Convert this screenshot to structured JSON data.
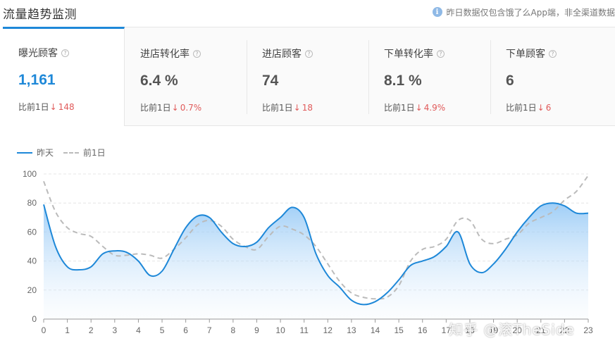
{
  "header": {
    "title": "流量趋势监测",
    "notice": "昨日数据仅包含饿了么App端，非全渠道数据",
    "info_icon": "info-icon"
  },
  "kpis": [
    {
      "label": "曝光顾客",
      "value": "1,161",
      "compare_label": "比前1日",
      "change": "148",
      "direction": "down",
      "active": true
    },
    {
      "label": "进店转化率",
      "value": "6.4 %",
      "compare_label": "比前1日",
      "change": "0.7%",
      "direction": "down",
      "active": false
    },
    {
      "label": "进店顾客",
      "value": "74",
      "compare_label": "比前1日",
      "change": "18",
      "direction": "down",
      "active": false
    },
    {
      "label": "下单转化率",
      "value": "8.1 %",
      "compare_label": "比前1日",
      "change": "4.9%",
      "direction": "down",
      "active": false
    },
    {
      "label": "下单顾客",
      "value": "6",
      "compare_label": "比前1日",
      "change": "6",
      "direction": "down",
      "active": false
    }
  ],
  "legend": {
    "current": "昨天",
    "previous": "前1日"
  },
  "watermark": "知乎 @滚TheSide",
  "colors": {
    "accent": "#1e88d8",
    "previous_line": "#bbbbbb",
    "down": "#e05a5a"
  },
  "chart_data": {
    "type": "line",
    "x": [
      0,
      0.5,
      1,
      1.5,
      2,
      2.5,
      3,
      3.5,
      4,
      4.5,
      5,
      5.5,
      6,
      6.5,
      7,
      7.5,
      8,
      8.5,
      9,
      9.5,
      10,
      10.5,
      11,
      11.5,
      12,
      12.5,
      13,
      13.5,
      14,
      14.5,
      15,
      15.5,
      16,
      16.5,
      17,
      17.5,
      18,
      18.5,
      19,
      19.5,
      20,
      20.5,
      21,
      21.5,
      22,
      22.5,
      23
    ],
    "xticks": [
      0,
      1,
      2,
      3,
      4,
      5,
      6,
      7,
      8,
      9,
      10,
      11,
      12,
      13,
      14,
      15,
      16,
      17,
      18,
      19,
      20,
      21,
      22,
      23
    ],
    "yticks": [
      0,
      20,
      40,
      60,
      80,
      100
    ],
    "ylim": [
      0,
      100
    ],
    "xlim": [
      0,
      23
    ],
    "grid": true,
    "legend_position": "top-left",
    "series": [
      {
        "name": "昨天",
        "style": "solid",
        "fill": true,
        "values": [
          79,
          50,
          36,
          34,
          36,
          45,
          47,
          46,
          40,
          30,
          33,
          48,
          63,
          71,
          70,
          60,
          52,
          50,
          53,
          63,
          70,
          77,
          70,
          45,
          30,
          22,
          13,
          10,
          12,
          18,
          27,
          37,
          40,
          43,
          50,
          60,
          38,
          32,
          38,
          48,
          60,
          70,
          78,
          80,
          78,
          73,
          73
        ]
      },
      {
        "name": "前1日",
        "style": "dashed",
        "fill": false,
        "values": [
          95,
          74,
          63,
          59,
          57,
          50,
          44,
          44,
          45,
          44,
          42,
          48,
          56,
          65,
          68,
          64,
          55,
          50,
          48,
          57,
          64,
          62,
          58,
          50,
          38,
          26,
          18,
          15,
          14,
          15,
          23,
          40,
          48,
          50,
          55,
          68,
          68,
          55,
          52,
          55,
          58,
          66,
          70,
          74,
          82,
          88,
          99
        ]
      }
    ]
  }
}
